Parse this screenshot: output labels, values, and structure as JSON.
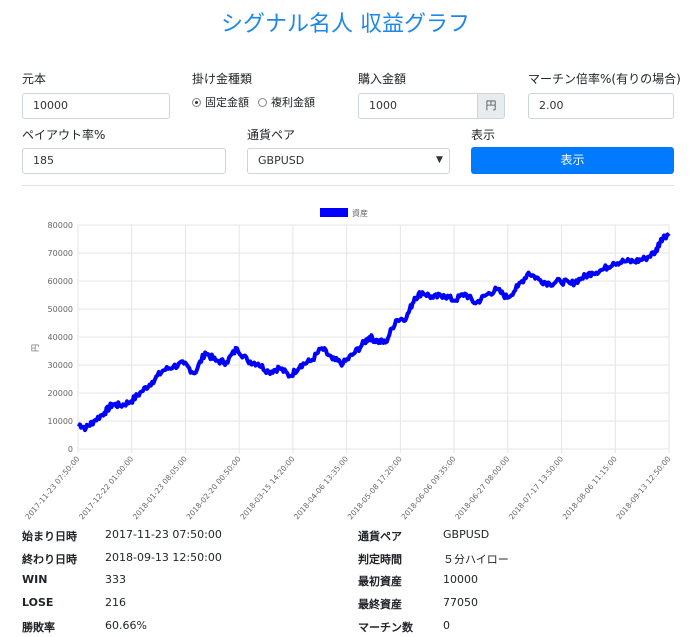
{
  "title": "シグナル名人 収益グラフ",
  "form": {
    "capital_label": "元本",
    "capital_value": "10000",
    "bet_type_label": "掛け金種類",
    "bet_options": [
      "固定金額",
      "複利金額"
    ],
    "purchase_label": "購入金額",
    "purchase_value": "1000",
    "purchase_unit": "円",
    "martingale_label": "マーチン倍率%(有りの場合)",
    "martingale_value": "2.00",
    "payout_label": "ペイアウト率%",
    "payout_value": "185",
    "pair_label": "通貨ペア",
    "pair_value": "GBPUSD",
    "display_label": "表示",
    "display_button": "表示"
  },
  "chart_data": {
    "type": "line",
    "legend": "資産",
    "ylabel": "円",
    "color": "#0000ff",
    "ylim": [
      0,
      80000
    ],
    "yticks": [
      0,
      10000,
      20000,
      30000,
      40000,
      50000,
      60000,
      70000,
      80000
    ],
    "xticks": [
      "2017-11-23 07:50:00",
      "2017-12-22 01:00:00",
      "2018-01-23 08:05:00",
      "2018-02-20 00:50:00",
      "2018-03-15 14:20:00",
      "2018-04-06 13:35:00",
      "2018-05-08 17:20:00",
      "2018-06-06 09:35:00",
      "2018-06-27 08:00:00",
      "2018-07-17 13:50:00",
      "2018-08-06 11:15:00",
      "2018-09-13 12:50:00"
    ],
    "x": [
      0,
      0.3,
      0.6,
      1,
      1.3,
      1.6,
      2,
      2.4,
      2.8,
      3.2,
      3.6,
      4,
      4.4,
      4.8,
      5.2,
      5.6,
      6,
      6.4,
      6.8,
      7.2,
      7.6,
      8,
      8.4,
      8.8,
      9.2,
      9.6,
      10,
      10.4,
      10.8,
      11,
      11.3,
      11.6,
      12,
      12.4,
      12.7,
      13
    ],
    "values": [
      9000,
      7500,
      10000,
      13000,
      16000,
      15500,
      17000,
      20500,
      24000,
      28000,
      29500,
      30500,
      27000,
      34500,
      31500,
      31000,
      36000,
      31500,
      30500,
      27500,
      29000,
      26000,
      30000,
      31500,
      36000,
      32000,
      30500,
      34000,
      38000,
      40000,
      38500,
      38000,
      46000,
      47000,
      54000,
      56000
    ]
  },
  "chart_extra": {
    "x2": [
      13,
      13.4,
      13.8,
      14.2,
      14.6,
      15,
      15.4,
      15.8,
      16.2,
      16.6,
      17,
      17.4,
      17.8,
      18.2,
      18.6,
      19,
      19.4,
      19.8,
      20.2,
      20.6,
      21,
      21.4,
      21.8,
      22,
      22.3
    ],
    "values2": [
      56000,
      54000,
      55000,
      53000,
      55500,
      52000,
      55000,
      57000,
      54000,
      58000,
      63000,
      60500,
      59000,
      60000,
      59000,
      61000,
      63000,
      64000,
      66500,
      67000,
      67000,
      68000,
      70500,
      75000,
      77000
    ]
  },
  "info_left": [
    {
      "k": "始まり日時",
      "v": "2017-11-23 07:50:00"
    },
    {
      "k": "終わり日時",
      "v": "2018-09-13 12:50:00"
    },
    {
      "k": "WIN",
      "v": "333"
    },
    {
      "k": "LOSE",
      "v": "216"
    },
    {
      "k": "勝敗率",
      "v": "60.66%"
    }
  ],
  "info_right": [
    {
      "k": "通貨ペア",
      "v": "GBPUSD"
    },
    {
      "k": "判定時間",
      "v": "５分ハイロー"
    },
    {
      "k": "最初資産",
      "v": "10000"
    },
    {
      "k": "最終資産",
      "v": "77050"
    },
    {
      "k": "マーチン数",
      "v": "0"
    }
  ]
}
